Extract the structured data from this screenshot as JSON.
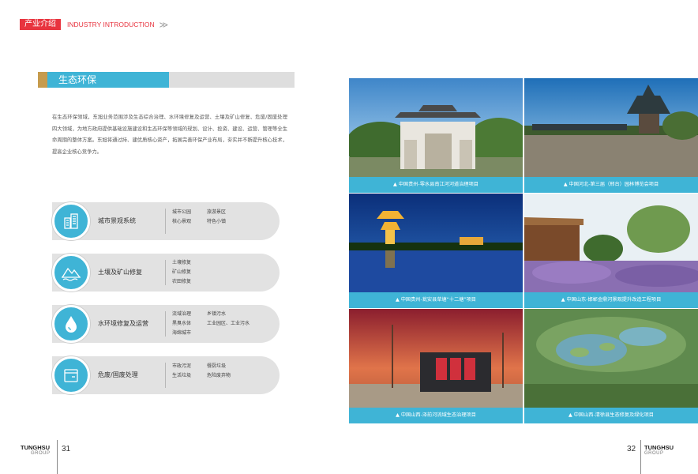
{
  "header": {
    "badge": "产业介绍",
    "english": "INDUSTRY INTRODUCTION",
    "arrow": "≫"
  },
  "section": {
    "title": "生态环保"
  },
  "intro": "在生态环保领域，东旭业务范围涉及生态综合治理、水环境修复及运营、土壤及矿山修复、危废/固废处理四大领域，为地方政府提供基础设施建设和生态环保等领域的规划、设计、投资、建设、运营、管理等全生命周期的整体方案。东旭将通过持、建优质核心资产，拓展完善环保产业布局，夯实并不断提升核心技术，提高企业核心竞争力。",
  "categories": [
    {
      "icon": "city-buildings-icon",
      "title": "城市景观系统",
      "items": [
        "城市公园",
        "旅游景区",
        "核心景观",
        "特色小镇"
      ]
    },
    {
      "icon": "mountain-icon",
      "title": "土壤及矿山修复",
      "items": [
        "土壤修复",
        "矿山修复",
        "农田修复"
      ]
    },
    {
      "icon": "water-drop-icon",
      "title": "水环境修复及运营",
      "items": [
        "流域治理",
        "乡镇污水",
        "黑臭水体",
        "工业园区、工业污水",
        "海绵城市"
      ]
    },
    {
      "icon": "waste-bin-icon",
      "title": "危废/固废处理",
      "items": [
        "市政污泥",
        "餐厨垃圾",
        "生活垃圾",
        "危险废弃物"
      ]
    }
  ],
  "photos": [
    {
      "caption": "▲  中国贵州-零水县南江河河道治理项目"
    },
    {
      "caption": "▲  中国河北-第三届（邢台）园林博览会项目"
    },
    {
      "caption": "▲  中国贵州-瓮安县草塘“十二塘”项目"
    },
    {
      "caption": "▲  中国山东-邯郸金鼎河景观提升改造工程项目"
    },
    {
      "caption": "▲  中国山西-泽前河流域生态治理项目"
    },
    {
      "caption": "▲  中国山西-清徐县生态修复及绿化项目"
    }
  ],
  "footer": {
    "left": {
      "brand": "TUNGHSU",
      "group": "GROUP",
      "page": "31"
    },
    "right": {
      "brand": "TUNGHSU",
      "group": "GROUP",
      "page": "32"
    }
  },
  "colors": {
    "accent_blue": "#3fb4d6",
    "accent_red": "#e8343f",
    "accent_gold": "#c69b4d"
  }
}
